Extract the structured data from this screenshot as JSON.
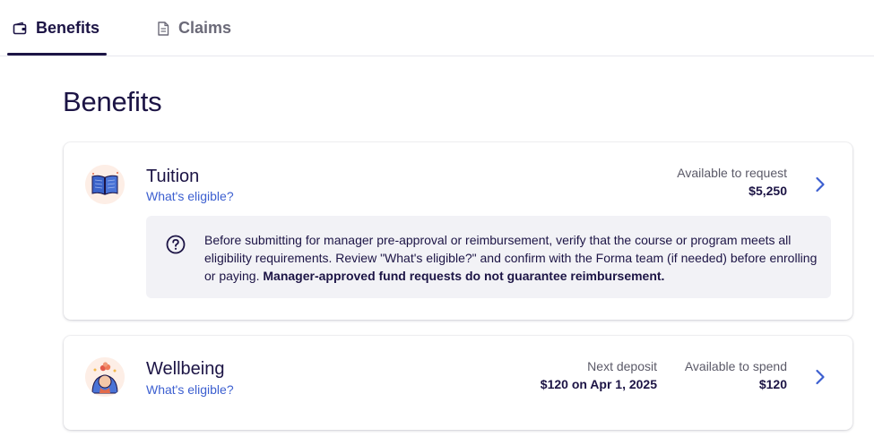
{
  "tabs": {
    "benefits_label": "Benefits",
    "claims_label": "Claims"
  },
  "page": {
    "title": "Benefits"
  },
  "benefits": [
    {
      "name": "Tuition",
      "eligible_link": "What's eligible?",
      "available_label": "Available to request",
      "available_value": "$5,250",
      "notice_text": "Before submitting for manager pre-approval or reimbursement, verify that the course or program meets all eligibility requirements. Review \"What's eligible?\" and confirm with the Forma team (if needed) before enrolling or paying. ",
      "notice_bold": "Manager-approved fund requests do not guarantee reimbursement."
    },
    {
      "name": "Wellbeing",
      "eligible_link": "What's eligible?",
      "deposit_label": "Next deposit",
      "deposit_value": "$120 on Apr 1, 2025",
      "available_label": "Available to spend",
      "available_value": "$120"
    }
  ],
  "colors": {
    "primary_text": "#1c1445",
    "link": "#3c5fd0",
    "muted": "#5b5a68",
    "notice_bg": "#f2f2f6"
  },
  "icons": [
    "wallet-icon",
    "document-icon",
    "book-icon",
    "wellbeing-person-icon",
    "chevron-right-icon",
    "question-circle-icon"
  ]
}
